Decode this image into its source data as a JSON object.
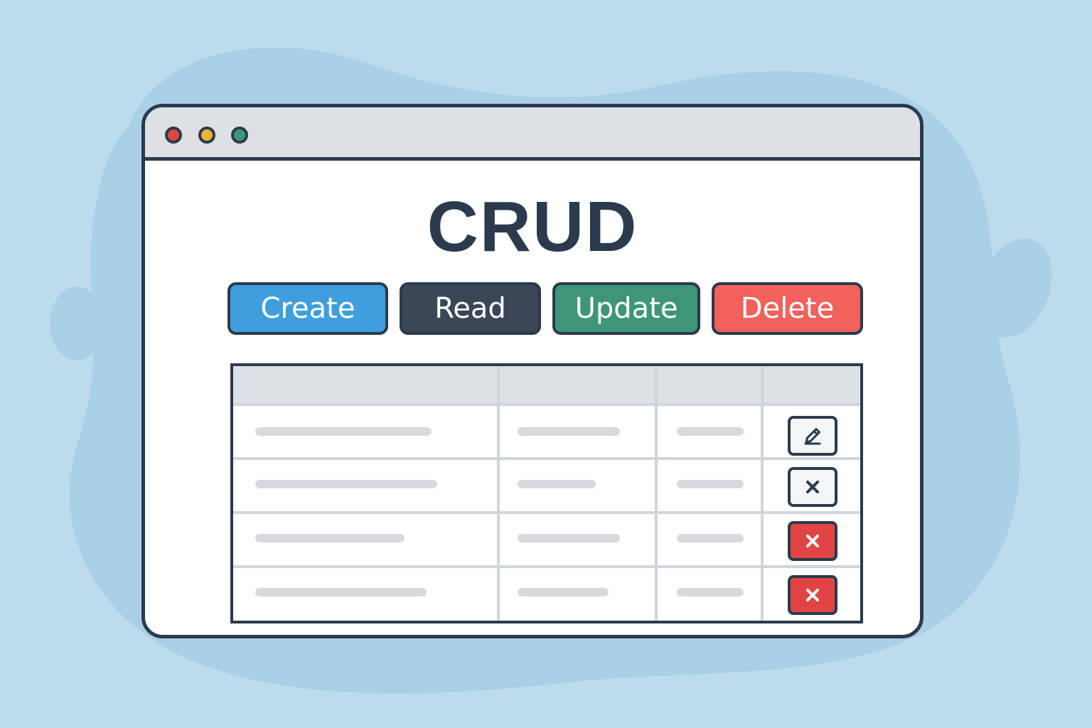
{
  "page": {
    "title": "CRUD"
  },
  "buttons": [
    {
      "label": "Create",
      "color": "#3f9fdc"
    },
    {
      "label": "Read",
      "color": "#3a4756"
    },
    {
      "label": "Update",
      "color": "#3e9677"
    },
    {
      "label": "Delete",
      "color": "#f0625b"
    }
  ],
  "window_controls": {
    "close_color": "#e2473f",
    "minimize_color": "#e8b534",
    "maximize_color": "#3a9878"
  },
  "table": {
    "columns": 4,
    "rows": [
      {
        "action": "edit",
        "action_icon": "pencil-icon"
      },
      {
        "action": "delete",
        "action_icon": "close-icon"
      },
      {
        "action": "delete",
        "action_icon": "close-icon",
        "highlighted": true
      },
      {
        "action": "delete",
        "action_icon": "close-icon",
        "highlighted": true
      }
    ]
  },
  "colors": {
    "background": "#bcdcee",
    "outline": "#2b3a4c",
    "danger": "#e04444"
  }
}
